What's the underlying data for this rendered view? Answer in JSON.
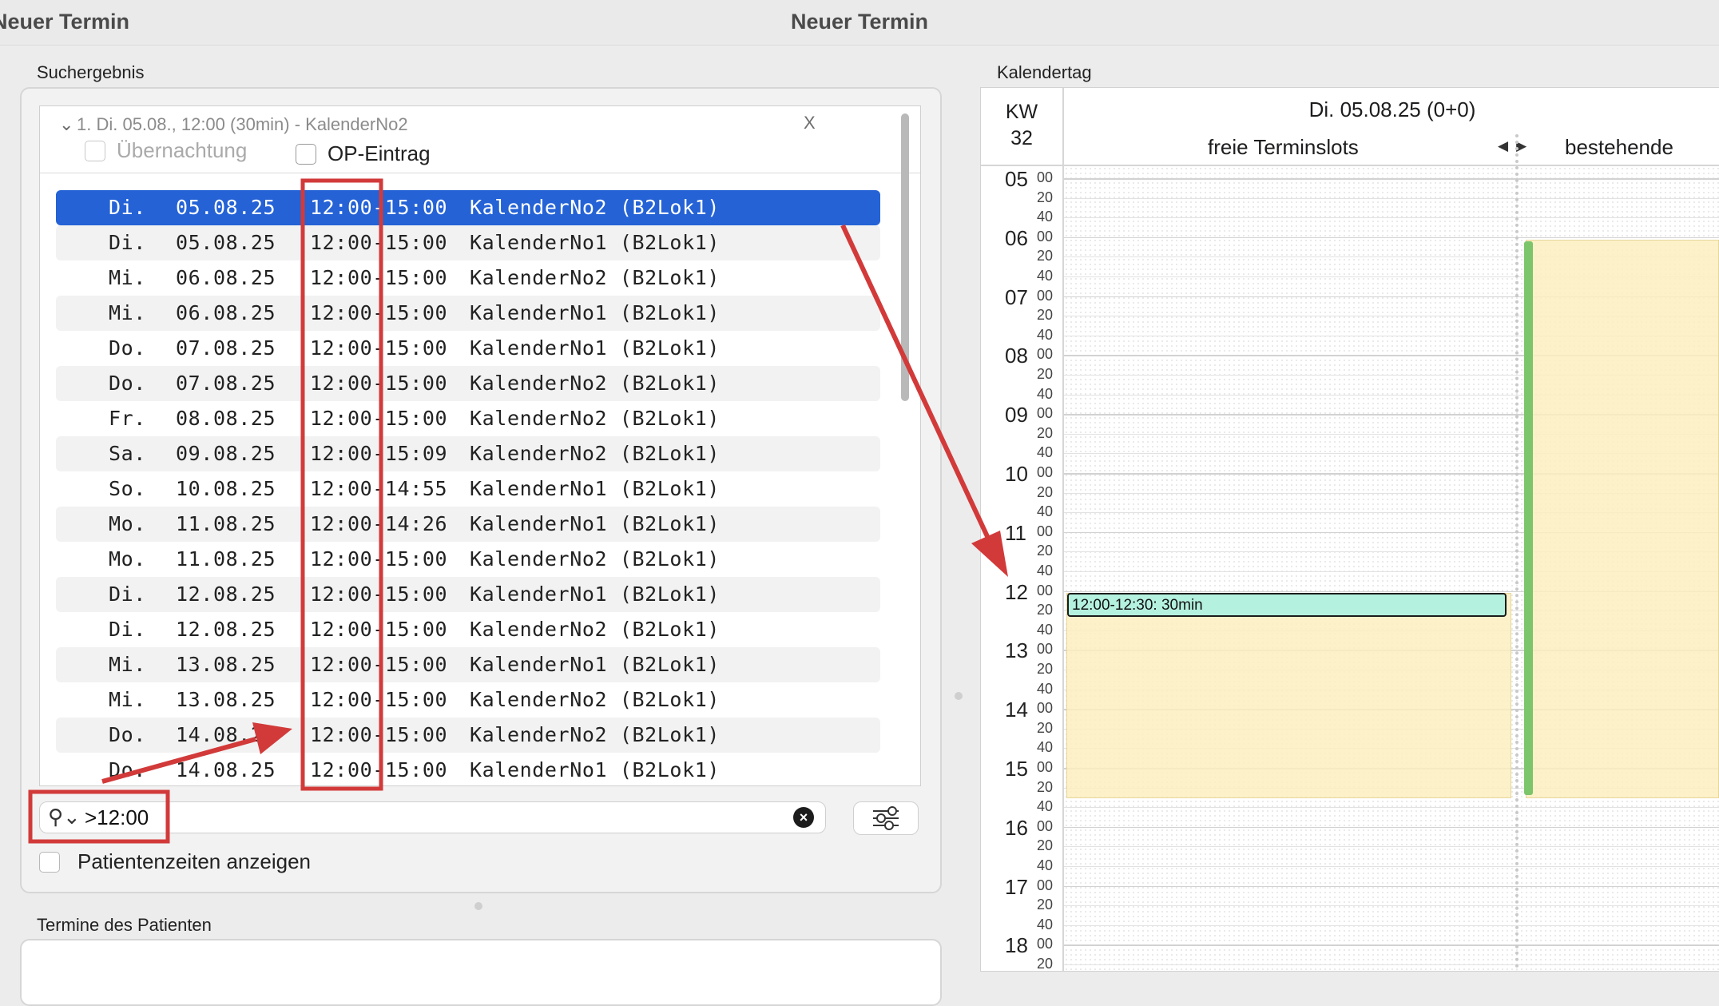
{
  "window": {
    "title": "Neuer Termin"
  },
  "search": {
    "section_label": "Suchergebnis",
    "group_header": "1. Di. 05.08., 12:00 (30min) - KalenderNo2",
    "close_label": "X",
    "checkbox_overnight": "Übernachtung",
    "checkbox_op": "OP-Eintrag",
    "rows": [
      {
        "day": "Di.",
        "date": "05.08.25",
        "time": "12:00-15:00",
        "calendar": "KalenderNo2 (B2Lok1)"
      },
      {
        "day": "Di.",
        "date": "05.08.25",
        "time": "12:00-15:00",
        "calendar": "KalenderNo1 (B2Lok1)"
      },
      {
        "day": "Mi.",
        "date": "06.08.25",
        "time": "12:00-15:00",
        "calendar": "KalenderNo2 (B2Lok1)"
      },
      {
        "day": "Mi.",
        "date": "06.08.25",
        "time": "12:00-15:00",
        "calendar": "KalenderNo1 (B2Lok1)"
      },
      {
        "day": "Do.",
        "date": "07.08.25",
        "time": "12:00-15:00",
        "calendar": "KalenderNo1 (B2Lok1)"
      },
      {
        "day": "Do.",
        "date": "07.08.25",
        "time": "12:00-15:00",
        "calendar": "KalenderNo2 (B2Lok1)"
      },
      {
        "day": "Fr.",
        "date": "08.08.25",
        "time": "12:00-15:00",
        "calendar": "KalenderNo2 (B2Lok1)"
      },
      {
        "day": "Sa.",
        "date": "09.08.25",
        "time": "12:00-15:09",
        "calendar": "KalenderNo2 (B2Lok1)"
      },
      {
        "day": "So.",
        "date": "10.08.25",
        "time": "12:00-14:55",
        "calendar": "KalenderNo1 (B2Lok1)"
      },
      {
        "day": "Mo.",
        "date": "11.08.25",
        "time": "12:00-14:26",
        "calendar": "KalenderNo1 (B2Lok1)"
      },
      {
        "day": "Mo.",
        "date": "11.08.25",
        "time": "12:00-15:00",
        "calendar": "KalenderNo2 (B2Lok1)"
      },
      {
        "day": "Di.",
        "date": "12.08.25",
        "time": "12:00-15:00",
        "calendar": "KalenderNo1 (B2Lok1)"
      },
      {
        "day": "Di.",
        "date": "12.08.25",
        "time": "12:00-15:00",
        "calendar": "KalenderNo2 (B2Lok1)"
      },
      {
        "day": "Mi.",
        "date": "13.08.25",
        "time": "12:00-15:00",
        "calendar": "KalenderNo1 (B2Lok1)"
      },
      {
        "day": "Mi.",
        "date": "13.08.25",
        "time": "12:00-15:00",
        "calendar": "KalenderNo2 (B2Lok1)"
      },
      {
        "day": "Do.",
        "date": "14.08.25",
        "time": "12:00-15:00",
        "calendar": "KalenderNo2 (B2Lok1)"
      },
      {
        "day": "Do.",
        "date": "14.08.25",
        "time": "12:00-15:00",
        "calendar": "KalenderNo1 (B2Lok1)"
      }
    ],
    "selected_index": 0,
    "query": ">12:00",
    "show_patient_times": "Patientenzeiten anzeigen"
  },
  "patient": {
    "section_label": "Termine des Patienten"
  },
  "calendar": {
    "section_label": "Kalendertag",
    "kw_label": "KW",
    "kw_number": "32",
    "day_title": "Di. 05.08.25 (0+0)",
    "col_free": "freie Terminslots",
    "col_existing": "bestehende",
    "hours": [
      "05",
      "06",
      "07",
      "08",
      "09",
      "10",
      "11",
      "12",
      "13",
      "14",
      "15",
      "16",
      "17",
      "18"
    ],
    "minutes": [
      "00",
      "20",
      "40"
    ],
    "slot_label": "12:00-12:30: 30min",
    "colors": {
      "slot": "#b4f1df",
      "free": "#fcefc0",
      "existing_bar": "#7cc56b",
      "selection": "#2462d6",
      "annotation": "#d23a3a"
    }
  }
}
